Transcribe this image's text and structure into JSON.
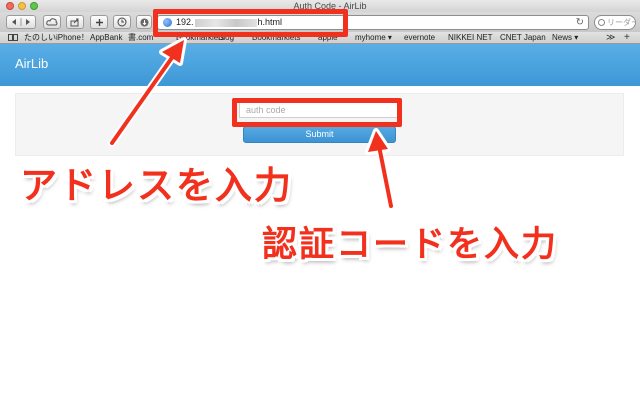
{
  "window": {
    "title": "Auth Code - AirLib"
  },
  "toolbar": {
    "url_prefix": "192.",
    "url_suffix": "h.html",
    "search_placeholder": "リーダー"
  },
  "bookmarks": {
    "items": [
      "たのしいiPhone！",
      "AppBank",
      "書.com",
      "Bookmarklets",
      "Blog",
      "Bookmarklets",
      "apple",
      "myhome ▾",
      "evernote",
      "NIKKEI NET",
      "CNET Japan",
      "News ▾"
    ],
    "more": "≫",
    "add": "+"
  },
  "app": {
    "brand": "AirLib"
  },
  "form": {
    "auth_placeholder": "auth code",
    "submit_label": "Submit"
  },
  "annotations": {
    "address_label": "アドレスを入力",
    "code_label": "認証コードを入力",
    "color": "#f2301e"
  }
}
